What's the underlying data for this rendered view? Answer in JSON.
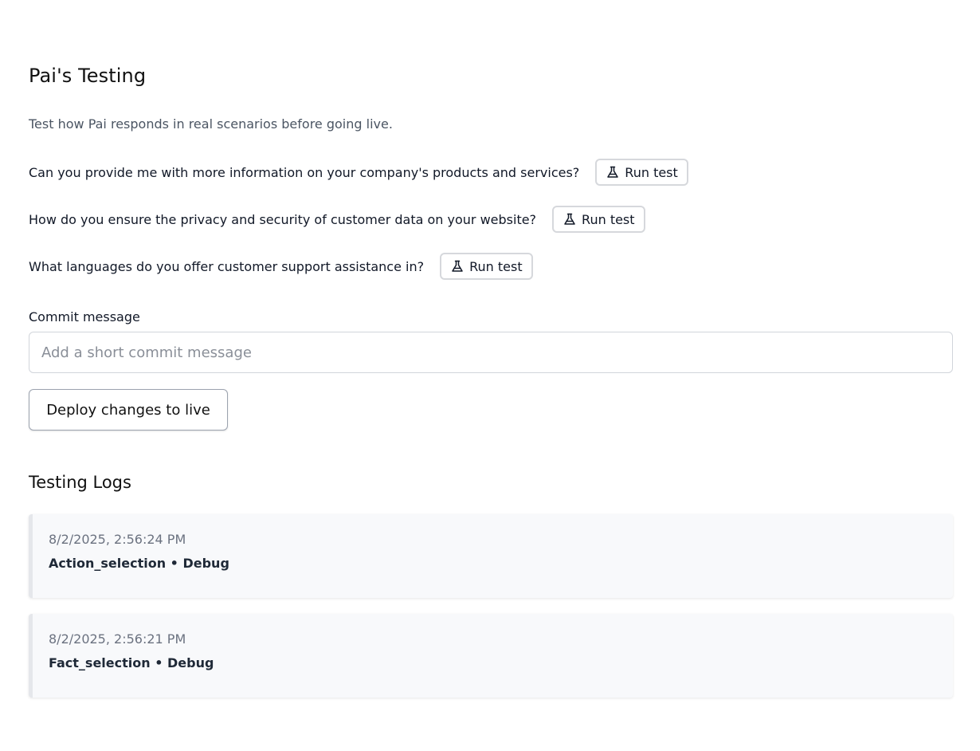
{
  "header": {
    "title": "Pai's Testing",
    "subtitle": "Test how Pai responds in real scenarios before going live."
  },
  "questions": [
    {
      "text": "Can you provide me with more information on your company's products and services?",
      "button_label": "Run test",
      "icon": "flask-icon"
    },
    {
      "text": "How do you ensure the privacy and security of customer data on your website?",
      "button_label": "Run test",
      "icon": "flask-icon"
    },
    {
      "text": "What languages do you offer customer support assistance in?",
      "button_label": "Run test",
      "icon": "flask-icon"
    }
  ],
  "commit": {
    "label": "Commit message",
    "placeholder": "Add a short commit message",
    "value": ""
  },
  "deploy": {
    "label": "Deploy changes to live"
  },
  "logs": {
    "title": "Testing Logs",
    "entries": [
      {
        "timestamp": "8/2/2025, 2:56:24 PM",
        "title": "Action_selection • Debug"
      },
      {
        "timestamp": "8/2/2025, 2:56:21 PM",
        "title": "Fact_selection • Debug"
      }
    ]
  },
  "colors": {
    "text": "#111827",
    "muted": "#6b7280",
    "border": "#d1d5db",
    "log_bg": "#f8f9fb"
  }
}
